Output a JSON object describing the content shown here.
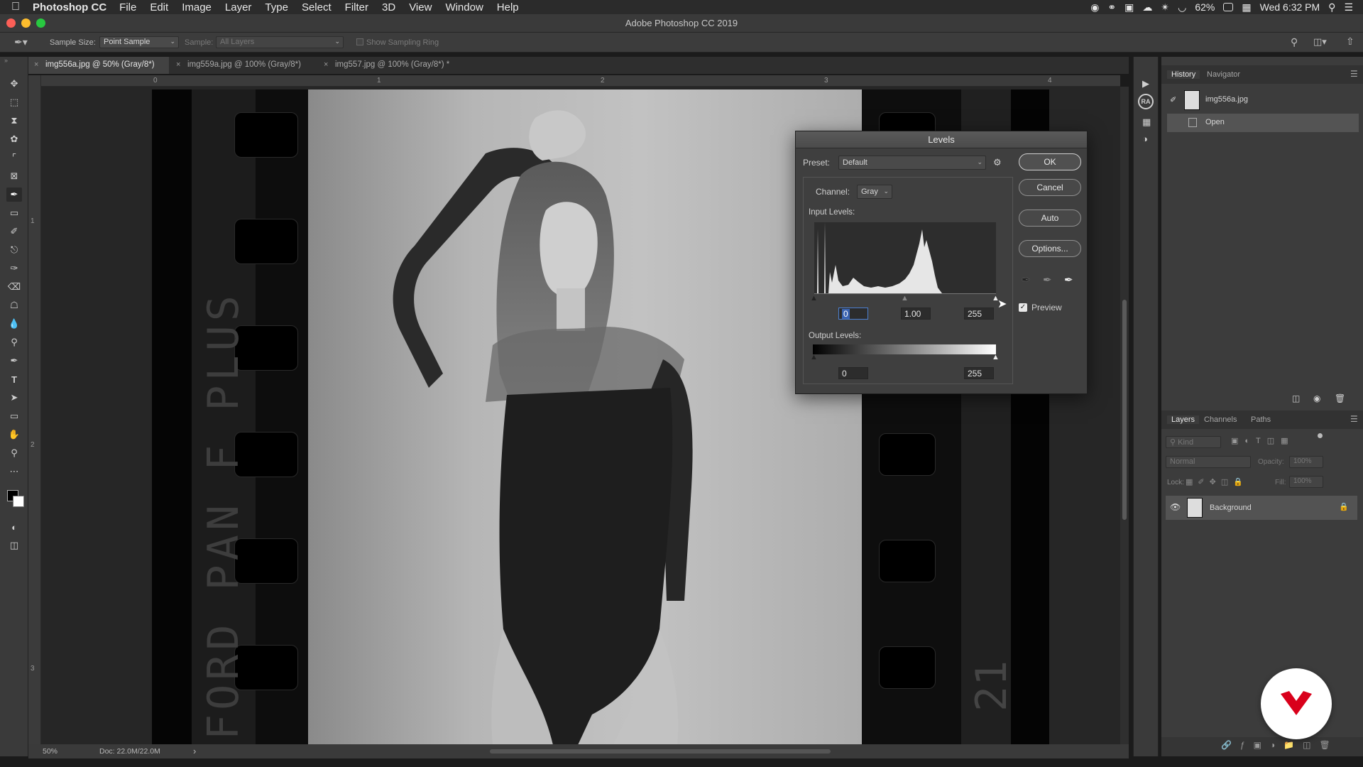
{
  "menubar": {
    "app_name": "Photoshop CC",
    "items": [
      "File",
      "Edit",
      "Image",
      "Layer",
      "Type",
      "Select",
      "Filter",
      "3D",
      "View",
      "Window",
      "Help"
    ],
    "battery": "62%",
    "clock": "Wed 6:32 PM"
  },
  "window": {
    "title": "Adobe Photoshop CC 2019"
  },
  "options_bar": {
    "sample_size_label": "Sample Size:",
    "sample_size_value": "Point Sample",
    "sample_label": "Sample:",
    "sample_value": "All Layers",
    "show_ring": "Show Sampling Ring"
  },
  "doc_tabs": [
    {
      "label": "img556a.jpg @ 50% (Gray/8*)",
      "active": true
    },
    {
      "label": "img559a.jpg @ 100% (Gray/8*)",
      "active": false
    },
    {
      "label": "img557.jpg @ 100% (Gray/8*) *",
      "active": false
    }
  ],
  "ruler": {
    "h": [
      "0",
      "1",
      "2",
      "3",
      "4"
    ],
    "v": [
      "1",
      "2",
      "3"
    ]
  },
  "film_text": {
    "left": "FORD PAN F PLUS",
    "right": "21"
  },
  "status": {
    "zoom": "50%",
    "doc": "Doc: 22.0M/22.0M",
    "arrow": "›"
  },
  "levels": {
    "title": "Levels",
    "preset_label": "Preset:",
    "preset_value": "Default",
    "channel_label": "Channel:",
    "channel_value": "Gray",
    "input_label": "Input Levels:",
    "input_black": "0",
    "input_gamma": "1.00",
    "input_white": "255",
    "output_label": "Output Levels:",
    "output_black": "0",
    "output_white": "255",
    "buttons": {
      "ok": "OK",
      "cancel": "Cancel",
      "auto": "Auto",
      "options": "Options..."
    },
    "preview_label": "Preview",
    "preview_checked": true
  },
  "history_panel": {
    "tabs": [
      "History",
      "Navigator"
    ],
    "snapshot": "img556a.jpg",
    "step": "Open"
  },
  "layers_panel": {
    "tabs": [
      "Layers",
      "Channels",
      "Paths"
    ],
    "kind_placeholder": "Kind",
    "blend_mode": "Normal",
    "opacity_label": "Opacity:",
    "opacity_value": "100%",
    "lock_label": "Lock:",
    "fill_label": "Fill:",
    "fill_value": "100%",
    "layer_name": "Background"
  },
  "right_strip": {
    "ra": "RA"
  },
  "colors": {
    "accent": "#d9001b",
    "dialog_bg": "#3f3f3f",
    "panel_bg": "#3c3c3c"
  }
}
